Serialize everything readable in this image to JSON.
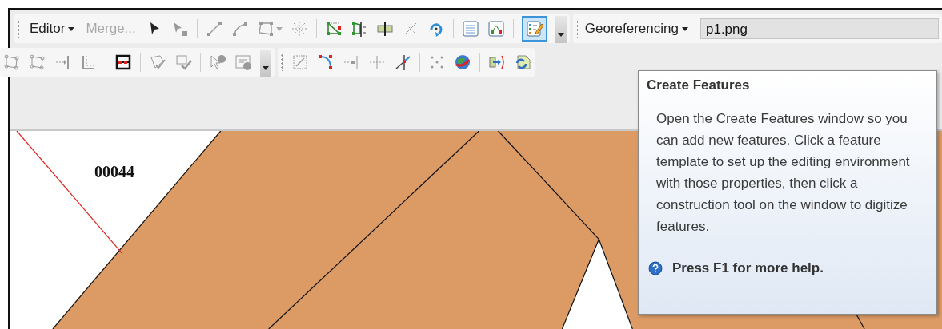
{
  "editor_toolbar": {
    "editor_menu": {
      "label": "Editor"
    },
    "merge_button": {
      "label": "Merge...",
      "disabled": true
    },
    "create_features_button": {
      "selected": true
    }
  },
  "georeferencing_toolbar": {
    "menu": {
      "label": "Georeferencing"
    },
    "layer_field": {
      "value": "p1.png"
    }
  },
  "map": {
    "label": "00044"
  },
  "tooltip": {
    "title": "Create Features",
    "body": "Open the Create Features window so you can add new features. Click a feature template to set up the editing environment with those properties, then click a construction tool on the window to digitize features.",
    "help": "Press F1 for more help."
  }
}
